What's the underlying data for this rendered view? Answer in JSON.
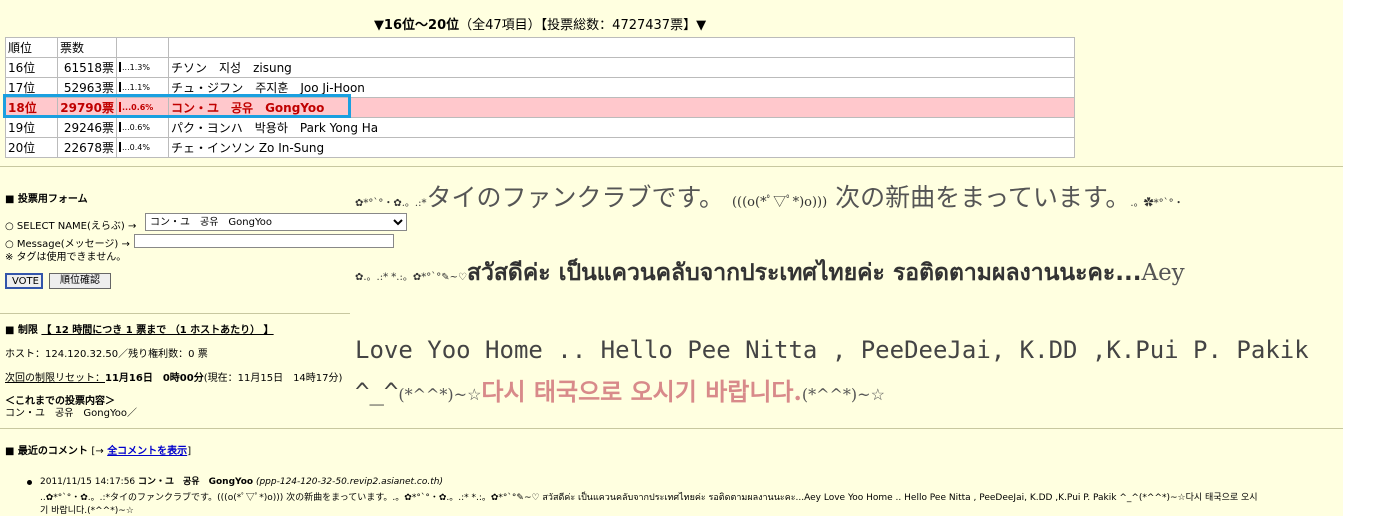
{
  "ranking": {
    "header_range": "▼16位〜20位",
    "header_meta": "（全47項目）【投票総数：4727437票】▼",
    "columns": [
      "順位",
      "票数",
      "",
      ""
    ],
    "rows": [
      {
        "rank": "16位",
        "votes": "61518票",
        "pct": "1.3%",
        "name": "チソン　지성　zisung",
        "highlight": false
      },
      {
        "rank": "17位",
        "votes": "52963票",
        "pct": "1.1%",
        "name": "チュ・ジフン　주지훈　Joo Ji-Hoon",
        "highlight": false
      },
      {
        "rank": "18位",
        "votes": "29790票",
        "pct": "0.6%",
        "name": "コン・ユ　공유　GongYoo",
        "highlight": true
      },
      {
        "rank": "19位",
        "votes": "29246票",
        "pct": "0.6%",
        "name": "パク・ヨンハ　박용하　Park Yong Ha",
        "highlight": false
      },
      {
        "rank": "20位",
        "votes": "22678票",
        "pct": "0.4%",
        "name": "チェ・インソン Zo In-Sung",
        "highlight": false
      }
    ]
  },
  "form": {
    "title": "■ 投票用フォーム",
    "select_label": "○ SELECT NAME(えらぶ) →",
    "select_value": "コン・ユ　공유　GongYoo",
    "message_label": "○ Message(メッセージ) →",
    "message_value": "",
    "tag_note": "※ タグは使用できません。",
    "vote_button": "VOTE",
    "confirm_button": "順位確認"
  },
  "limit": {
    "label": "■ 制限",
    "rule": "【 12 時間につき 1 票まで （1 ホストあたり） 】",
    "host_line": "ホスト：124.120.32.50／残り権利数：0 票",
    "reset_prefix": "次回の制限リセット：",
    "reset_value": "11月16日　0時00分",
    "reset_current": "(現在：11月15日　14時17分)",
    "history_title": "＜これまでの投票内容＞",
    "history_value": "コン・ユ　공유　GongYoo／"
  },
  "message_display": {
    "line1_sym_left": "✿*°`°・✿.。.:*",
    "line1_text_a": "タイのファンクラブです。",
    "line1_face": "(((o(*ﾟ▽ﾟ*)o)))",
    "line1_text_b": "次の新曲をまっています。",
    "line1_sym_right": ".。✿*°`°・",
    "line2_sym": "✿.。.:* *.:。✿*°`°✎~♡",
    "line2_thai": "สวัสดีค่ะ เป็นแควนคลับจากประเทศไทยค่ะ รอติดตามผลงานนะคะ...",
    "line2_tail": "Aey",
    "line3": "Love Yoo Home .. Hello Pee Nitta , PeeDeeJai, K.DD ,K.Pui P. Pakik",
    "line4_a": "^_^",
    "line4_b": "(*^^*)~☆",
    "line4_korean": "다시 태국으로 오시기 바랍니다.",
    "line4_c": "(*^^*)~☆"
  },
  "comments": {
    "title": "■ 最近のコメント",
    "show_all_prefix": "[→",
    "show_all_link": "全コメントを表示",
    "show_all_suffix": "]",
    "items": [
      {
        "timestamp": "2011/11/15 14:17:56",
        "name": "コン・ユ　공유　GongYoo",
        "host": "(ppp-124-120-32-50.revip2.asianet.co.th)",
        "body1": "..✿*°`°・✿.。.:*タイのファンクラブです。(((o(*ﾟ▽ﾟ*)o))) 次の新曲をまっています。.。✿*°`°・✿.。.:* *.:。✿*°`°✎~♡ สวัสดีค่ะ เป็นแควนคลับจากประเทศไทยค่ะ รอติดตามผลงานนะคะ...Aey Love Yoo Home .. Hello Pee Nitta , PeeDeeJai, K.DD ,K.Pui P. Pakik ^_^(*^^*)~☆다시 태국으로 오시",
        "body2": "기 바랍니다.(*^^*)~☆"
      }
    ]
  }
}
